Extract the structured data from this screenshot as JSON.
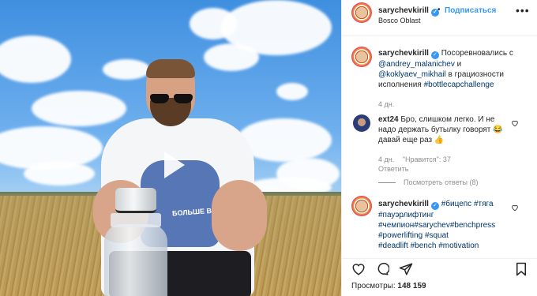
{
  "post": {
    "username": "sarychevkirill",
    "follow_label": "Подписаться",
    "location": "Bosco Oblast",
    "verified_mark": "✓"
  },
  "video": {
    "print_text": "БОЛЬШЕ ВСЕХ"
  },
  "caption": {
    "username": "sarychevkirill",
    "text": "Посоревновались с",
    "mention1": "@andrey_malanichev",
    "and": "и",
    "mention2": "@koklyaev_mikhail",
    "tail": "в грациозности исполнения",
    "hashtag": "#bottlecapchallenge",
    "time": "4 дн."
  },
  "comment1": {
    "username": "ext24",
    "text": "Бро, слишком легко. И не надо держать бутылку говорят",
    "emoji": "😂",
    "text2": "давай еще раз",
    "emoji2": "👍",
    "time": "4 дн.",
    "likes": "\"Нравится\": 37",
    "reply": "Ответить",
    "view_replies": "Посмотреть ответы (8)"
  },
  "comment2": {
    "username": "sarychevkirill",
    "tags": [
      [
        "#бицепс",
        "#тяга"
      ],
      [
        "#пауэрлифтинг"
      ],
      [
        "#чемпион",
        "#sarychev",
        "#benchpress"
      ],
      [
        "#powerlifting",
        "#squat"
      ],
      [
        "#deadlift",
        "#bench",
        "#motivation"
      ]
    ]
  },
  "footer": {
    "views_label": "Просмотры:",
    "views_count": "148 159"
  }
}
